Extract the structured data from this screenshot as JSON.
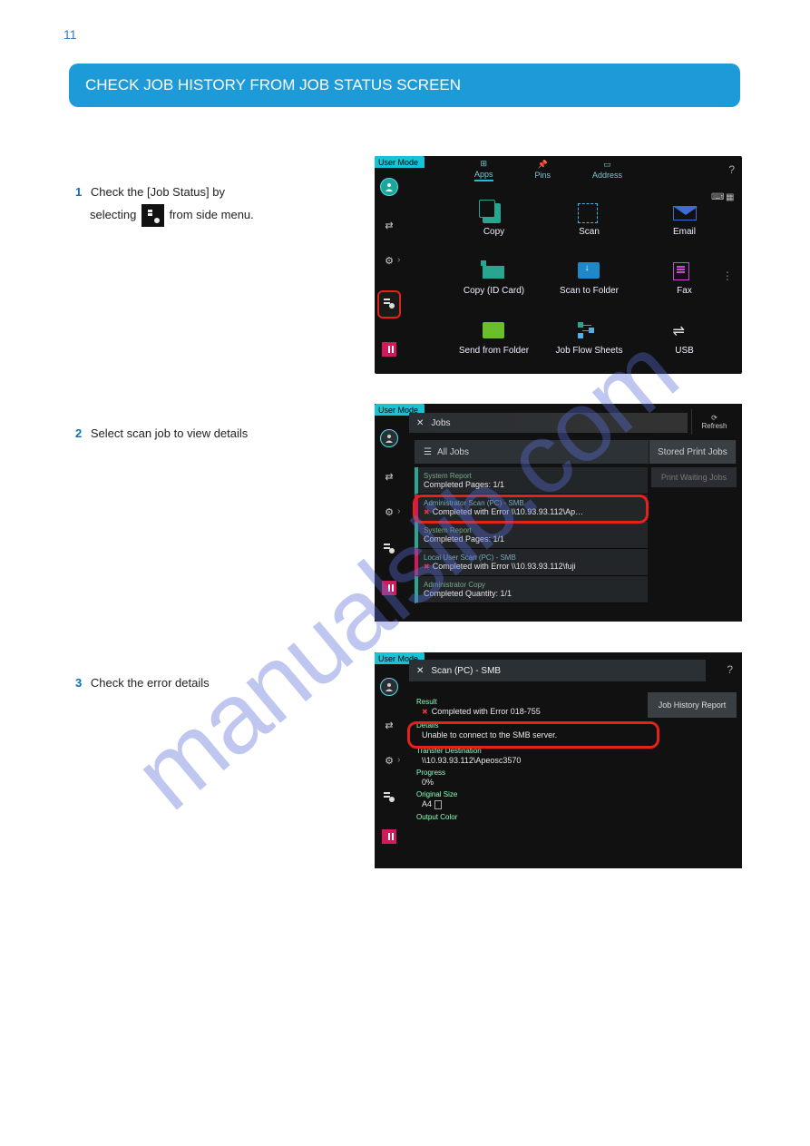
{
  "page_number": "11",
  "header_title": "CHECK JOB HISTORY FROM JOB STATUS SCREEN",
  "instructions": {
    "step1_num": "1",
    "step1_a": "Check the [Job Status] by",
    "step1_b": "selecting",
    "step1_c": "from side menu.",
    "step2_num": "2",
    "step2": "Select scan job to view details",
    "step3_num": "3",
    "step3": "Check the error details"
  },
  "watermark": "manualslib.com",
  "shot1": {
    "usermode": "User Mode",
    "nav": {
      "apps": "Apps",
      "pins": "Pins",
      "address": "Address"
    },
    "help": "?",
    "apps": {
      "copy": "Copy",
      "scan": "Scan",
      "email": "Email",
      "idcard": "Copy (ID Card)",
      "stf": "Scan to Folder",
      "fax": "Fax",
      "sff": "Send from Folder",
      "jfs": "Job Flow Sheets",
      "usb": "USB"
    }
  },
  "shot2": {
    "usermode": "User Mode",
    "title": "Jobs",
    "refresh": "Refresh",
    "alljobs": "All Jobs",
    "spj": "Stored Print Jobs",
    "pwj": "Print Waiting Jobs",
    "rows": [
      {
        "top": "System     Report",
        "bot": "Completed  Pages: 1/1",
        "err": false
      },
      {
        "top": "Administrator     Scan (PC) - SMB",
        "bot": "Completed with Error  \\\\10.93.93.112\\Ap…",
        "err": true
      },
      {
        "top": "System     Report",
        "bot": "Completed  Pages: 1/1",
        "err": false
      },
      {
        "top": "Local User     Scan (PC) - SMB",
        "bot": "Completed with Error  \\\\10.93.93.112\\fuji",
        "err": true
      },
      {
        "top": "Administrator     Copy",
        "bot": "Completed  Quantity: 1/1",
        "err": false
      }
    ]
  },
  "shot3": {
    "usermode": "User Mode",
    "title": "Scan (PC) - SMB",
    "help": "?",
    "jhr": "Job History Report",
    "result_lbl": "Result",
    "result_val": "Completed with Error 018-755",
    "details_lbl": "Details",
    "details_val": "Unable to connect to the SMB server.",
    "dest_lbl": "Transfer Destination",
    "dest_val": "\\\\10.93.93.112\\Apeosc3570",
    "prog_lbl": "Progress",
    "prog_val": "0%",
    "orig_lbl": "Original Size",
    "orig_val": "A4",
    "out_lbl": "Output Color"
  }
}
